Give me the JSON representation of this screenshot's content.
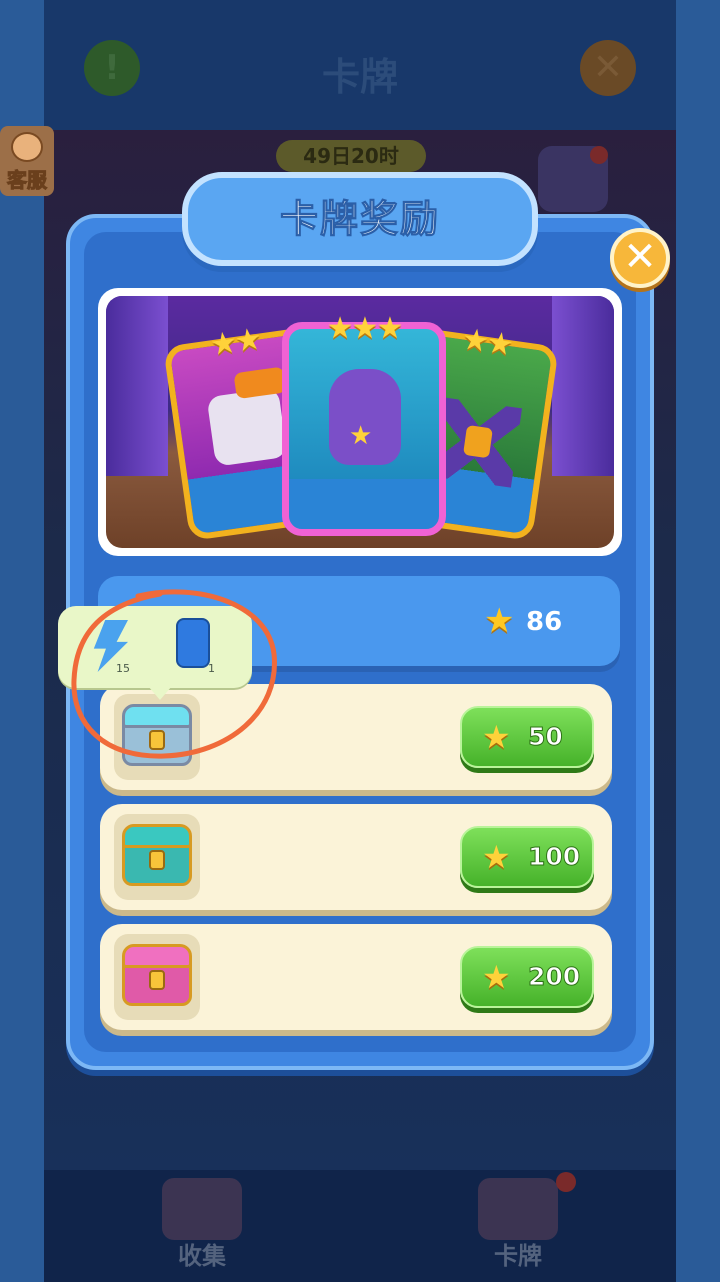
{
  "header": {
    "title": "卡牌",
    "info_icon": "exclamation-icon",
    "close_icon": "close-icon",
    "info_symbol": "!",
    "close_symbol": "✕"
  },
  "event": {
    "timer": "49日20时"
  },
  "customer_service": {
    "label": "客服"
  },
  "modal": {
    "title": "卡牌奖励",
    "close_symbol": "✕",
    "banner_stars": {
      "left": "★★",
      "center": "★★★",
      "right": "★★"
    },
    "total_stars": "86",
    "star_glyph": "★",
    "rewards": [
      {
        "chest": "silver-chest",
        "cost": "50"
      },
      {
        "chest": "gold-chest",
        "cost": "100"
      },
      {
        "chest": "pink-chest",
        "cost": "200"
      }
    ],
    "tooltip": {
      "items": [
        {
          "icon": "lightning-icon",
          "count": "15"
        },
        {
          "icon": "pouch-icon",
          "count": "1"
        }
      ]
    }
  },
  "bottom_tabs": [
    {
      "label": "收集",
      "icon": "collection-icon"
    },
    {
      "label": "卡牌",
      "icon": "cards-icon"
    }
  ],
  "colors": {
    "modal_blue": "#3f86e2",
    "claim_green": "#46b22a",
    "annotation": "#f06a3a"
  }
}
